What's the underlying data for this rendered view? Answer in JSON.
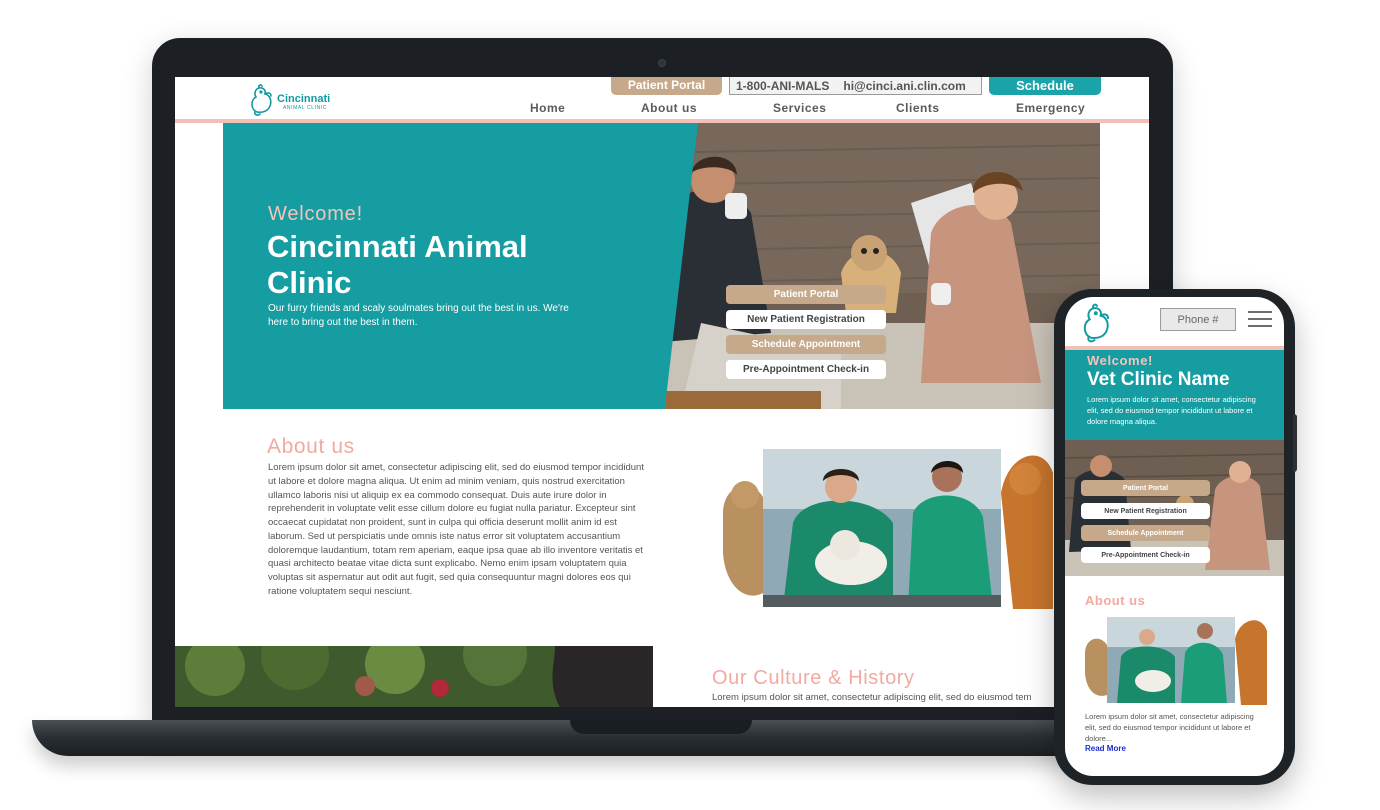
{
  "site": {
    "logo": {
      "name": "Cincinnati",
      "sub": "ANIMAL CLINIC"
    },
    "topbar": {
      "portal_label": "Patient Portal",
      "phone": "1-800-ANI-MALS",
      "email": "hi@cinci.ani.clin.com",
      "schedule_label": "Schedule"
    },
    "nav": [
      "Home",
      "About us",
      "Services",
      "Clients",
      "Emergency"
    ],
    "hero": {
      "welcome": "Welcome!",
      "title": "Cincinnati Animal Clinic",
      "tagline": "Our furry friends and scaly soulmates bring out the best in us. We're here to bring out the best in them.",
      "buttons": [
        "Patient Portal",
        "New Patient Registration",
        "Schedule Appointment",
        "Pre-Appointment Check-in"
      ]
    },
    "about": {
      "title": "About us",
      "body": "Lorem ipsum dolor sit amet, consectetur adipiscing elit, sed do eiusmod tempor incididunt ut labore et dolore magna aliqua. Ut enim ad minim veniam, quis nostrud exercitation ullamco laboris nisi ut aliquip ex ea commodo consequat. Duis aute irure dolor in reprehenderit in voluptate velit esse cillum dolore eu fugiat nulla pariatur. Excepteur sint occaecat cupidatat non proident, sunt in culpa qui officia deserunt mollit anim id est laborum. Sed ut perspiciatis unde omnis iste natus error sit voluptatem accusantium doloremque laudantium, totam rem aperiam, eaque ipsa quae ab illo inventore veritatis et quasi architecto beatae vitae dicta sunt explicabo. Nemo enim ipsam voluptatem quia voluptas sit aspernatur aut odit aut fugit, sed quia consequuntur magni dolores eos qui ratione voluptatem sequi nesciunt."
    },
    "culture": {
      "title": "Our Culture & History",
      "body": "Lorem ipsum dolor sit amet, consectetur adipiscing elit, sed do eiusmod tem"
    }
  },
  "phone": {
    "phone_placeholder": "Phone #",
    "hero": {
      "welcome": "Welcome!",
      "title": "Vet Clinic Name",
      "tagline": "Lorem ipsum dolor sit amet, consectetur adipiscing elit, sed do eiusmod tempor incididunt ut labore et dolore magna aliqua.",
      "buttons": [
        "Patient Portal",
        "New Patient Registration",
        "Schedule Appointment",
        "Pre-Appointment Check-in"
      ]
    },
    "about": {
      "title": "About us",
      "body": "Lorem ipsum dolor sit amet, consectetur adipiscing elit, sed do eiusmod tempor incididunt ut labore et dolore...",
      "read_more": "Read More"
    }
  },
  "colors": {
    "teal": "#169da2",
    "salmon": "#f2aaa0",
    "tan": "#c6a98b",
    "device": "#1c2024"
  },
  "icons": [
    "clinic-logo-icon",
    "hamburger-menu-icon"
  ]
}
